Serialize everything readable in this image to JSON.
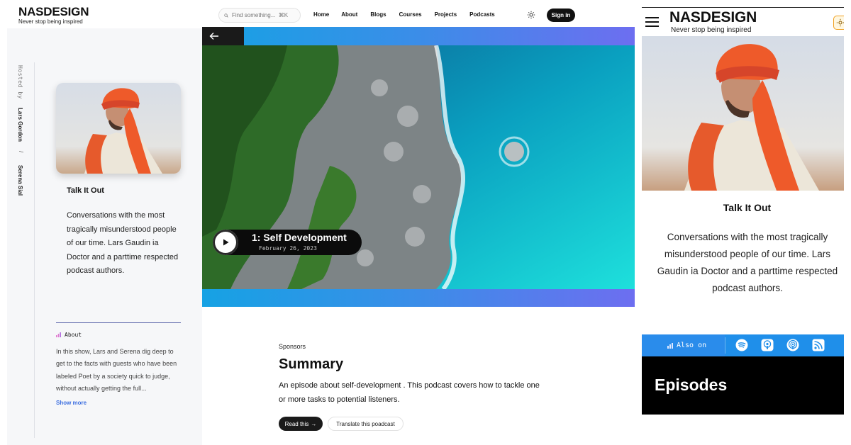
{
  "brand": {
    "name": "NASDESIGN",
    "tagline": "Never stop being inspired"
  },
  "search": {
    "placeholder": "Find something...  ⌘K"
  },
  "nav": {
    "items": [
      "Home",
      "About",
      "Blogs",
      "Courses",
      "Projects",
      "Podcasts"
    ]
  },
  "header": {
    "signin_label": "Sign in"
  },
  "hosts": {
    "label": "Hosted by",
    "host_1": "Lars Gordon",
    "separator": "/",
    "host_2": "Serena Sial"
  },
  "show": {
    "title": "Talk It Out",
    "description": "Conversations with the most tragically misunderstood people of our time. Lars Gaudin ia Doctor and a parttime respected podcast authors."
  },
  "about": {
    "heading": "About",
    "text": "In this show, Lars and Serena dig deep to get to the facts with guests who have been labeled Poet by a society quick to judge, without actually getting the full...",
    "show_more_label": "Show more"
  },
  "episode": {
    "title": "1: Self Development",
    "date": "February 26, 2023"
  },
  "summary": {
    "sponsors_label": "Sponsors",
    "heading": "Summary",
    "text": "An episode about self-development . This podcast covers how to tackle one or more tasks to potential listeners.",
    "read_label": "Read this",
    "read_arrow": "→",
    "translate_label": "Translate this poadcast"
  },
  "mobile": {
    "also_on_label": "Also on",
    "platforms": [
      "spotify-icon",
      "apple-podcasts-icon",
      "podcasts-icon",
      "rss-icon"
    ],
    "episodes_heading": "Episodes"
  },
  "colors": {
    "accent_blue": "#3d6fe0",
    "hero_gradient": [
      "#16a2e4",
      "#6d6ef0"
    ],
    "dark": "#111111",
    "sidebar_bg": "#f6f7f9"
  }
}
